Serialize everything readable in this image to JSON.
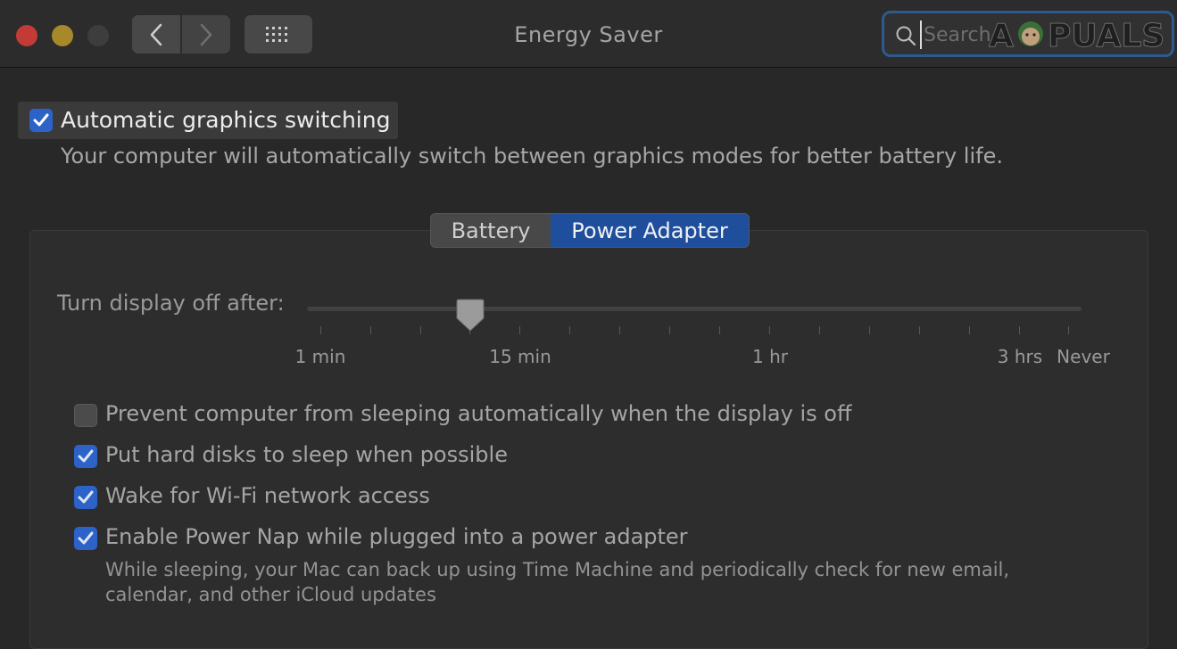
{
  "window": {
    "title": "Energy Saver"
  },
  "search": {
    "placeholder": "Search",
    "value": ""
  },
  "watermark": {
    "text": "APPUALS"
  },
  "graphics": {
    "label": "Automatic graphics switching",
    "checked": true,
    "description": "Your computer will automatically switch between graphics modes for better battery life."
  },
  "tabs": [
    {
      "label": "Battery",
      "selected": false
    },
    {
      "label": "Power Adapter",
      "selected": true
    }
  ],
  "display_sleep": {
    "label": "Turn display off after:",
    "tick_labels": [
      "1 min",
      "15 min",
      "1 hr",
      "3 hrs",
      "Never"
    ],
    "value": "15 min"
  },
  "options": [
    {
      "label": "Prevent computer from sleeping automatically when the display is off",
      "checked": false
    },
    {
      "label": "Put hard disks to sleep when possible",
      "checked": true
    },
    {
      "label": "Wake for Wi-Fi network access",
      "checked": true
    },
    {
      "label": "Enable Power Nap while plugged into a power adapter",
      "checked": true,
      "description": "While sleeping, your Mac can back up using Time Machine and periodically check for new email, calendar, and other iCloud updates"
    }
  ],
  "colors": {
    "accent": "#2d62c8",
    "selected_tab": "#1f4f9c",
    "background": "#282828"
  },
  "icons": [
    "chevron-left-icon",
    "chevron-right-icon",
    "grid-icon",
    "search-icon",
    "checkmark-icon"
  ]
}
